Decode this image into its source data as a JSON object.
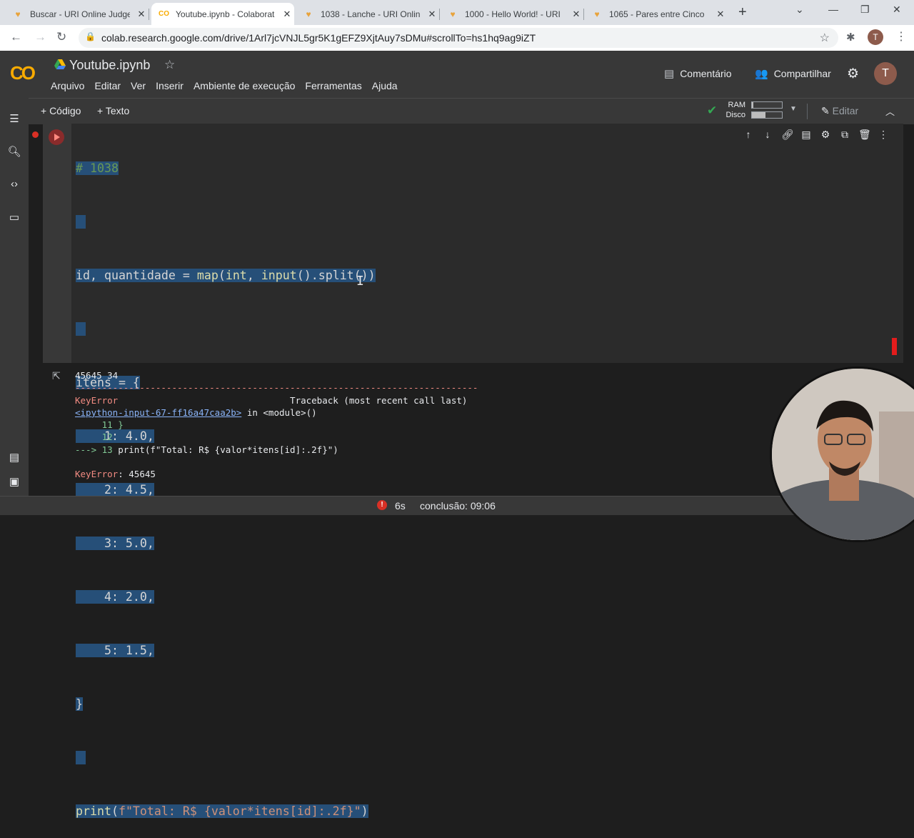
{
  "browser": {
    "tabs": [
      {
        "title": "Buscar - URI Online Judge",
        "active": false,
        "icon": "uri-favicon-icon"
      },
      {
        "title": "Youtube.ipynb - Colaborat",
        "active": true,
        "icon": "colab-favicon-icon"
      },
      {
        "title": "1038 - Lanche - URI Onlin",
        "active": false,
        "icon": "uri-favicon-icon"
      },
      {
        "title": "1000 - Hello World! - URI",
        "active": false,
        "icon": "uri-favicon-icon"
      },
      {
        "title": "1065 - Pares entre Cinco",
        "active": false,
        "icon": "uri-favicon-icon"
      }
    ],
    "url": "colab.research.google.com/drive/1Arl7jcVNJL5gr5K1gEFZ9XjtAuy7sDMu#scrollTo=hs1hq9ag9iZT",
    "profile_initial": "T"
  },
  "colab": {
    "logo": "CO",
    "notebook_title": "Youtube.ipynb",
    "menu": [
      "Arquivo",
      "Editar",
      "Ver",
      "Inserir",
      "Ambiente de execução",
      "Ferramentas",
      "Ajuda"
    ],
    "comment_label": "Comentário",
    "share_label": "Compartilhar",
    "avatar_initial": "T"
  },
  "toolbar": {
    "add_code": "+ Código",
    "add_text": "+ Texto",
    "ram_label": "RAM",
    "disk_label": "Disco",
    "ram_usage": 0.05,
    "disk_usage": 0.45,
    "edit_label": "Editar"
  },
  "cell": {
    "lines": [
      "# 1038",
      "",
      "id, quantidade = map(int, input().split())",
      "",
      "itens = {",
      "    1: 4.0,",
      "    2: 4.5,",
      "    3: 5.0,",
      "    4: 2.0,",
      "    5: 1.5,",
      "}",
      "",
      "print(f\"Total: R$ {valor*itens[id]:.2f}\")"
    ]
  },
  "output": {
    "input_echo": "45645 34",
    "dashes": "---------------------------------------------------------------------------",
    "error_type": "KeyError",
    "traceback_header": "Traceback (most recent call last)",
    "input_ref": "<ipython-input-67-ff16a47caa2b>",
    "in_module": " in <module>()",
    "tb_line1": "     11 }",
    "tb_line2": "     12 ",
    "tb_arrow": "---> 13 ",
    "tb_code": "print(f\"Total: R$ {valor*itens[id]:.2f}\")",
    "final_error": "KeyError",
    "final_msg": ": 45645"
  },
  "status": {
    "duration": "6s",
    "completion": "conclusão: 09:06"
  }
}
